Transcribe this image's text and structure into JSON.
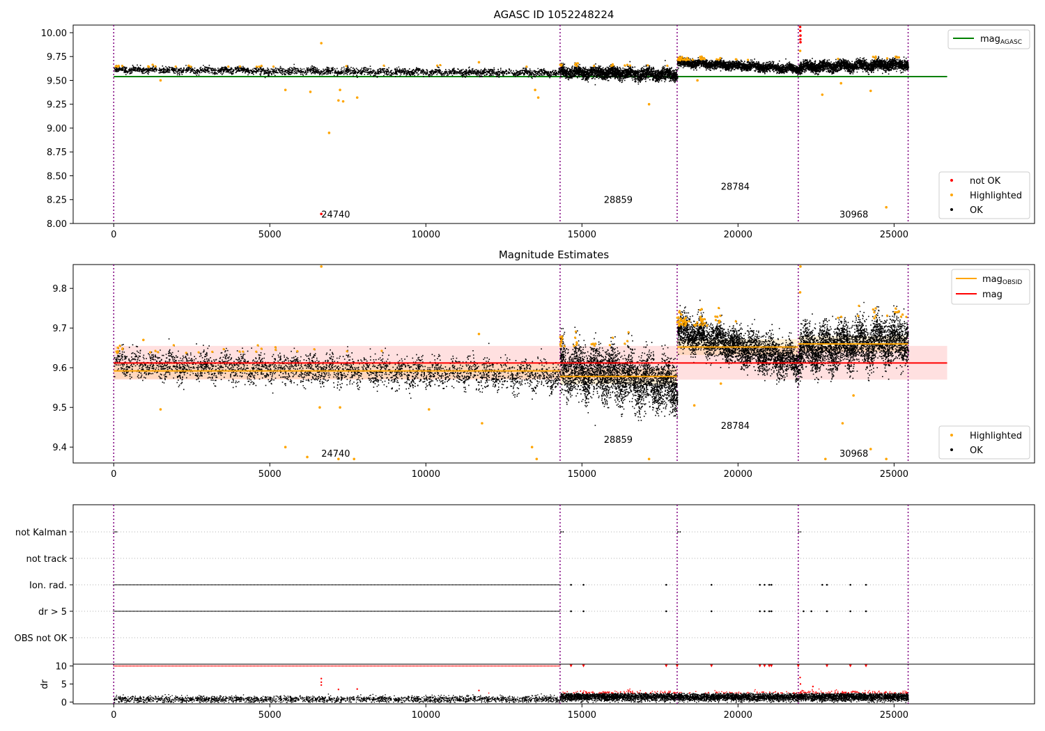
{
  "chart_data": [
    {
      "type": "scatter",
      "title": "AGASC ID 1052248224",
      "x_ticks": [
        0,
        5000,
        10000,
        15000,
        20000,
        25000
      ],
      "y_ticks": [
        "8.00",
        "8.25",
        "8.50",
        "8.75",
        "9.00",
        "9.25",
        "9.50",
        "9.75",
        "10.00"
      ],
      "xlim": [
        -1300,
        29500
      ],
      "ylim": [
        8.0,
        10.08
      ],
      "reference_line": {
        "label": "mag",
        "label_sub": "AGASC",
        "value": 9.54,
        "x_range": [
          0,
          26700
        ],
        "color": "#008000"
      },
      "obsid_boundaries": [
        0,
        14300,
        18050,
        21930,
        25450
      ],
      "segments": [
        {
          "x0": 0,
          "x1": 14300,
          "mean": 9.6,
          "slope": -0.035,
          "spread": 0.018
        },
        {
          "x0": 14300,
          "x1": 18050,
          "mean": 9.58,
          "slope": -0.03,
          "spread": 0.03
        },
        {
          "x0": 18050,
          "x1": 21930,
          "mean": 9.66,
          "slope": -0.07,
          "spread": 0.022
        },
        {
          "x0": 21930,
          "x1": 25450,
          "mean": 9.66,
          "slope": 0.03,
          "spread": 0.028
        }
      ],
      "obsid_labels": [
        {
          "text": "24740",
          "x": 6650,
          "y": 8.1
        },
        {
          "text": "28859",
          "x": 15700,
          "y": 8.25
        },
        {
          "text": "28784",
          "x": 19450,
          "y": 8.39
        },
        {
          "text": "30968",
          "x": 23250,
          "y": 8.1
        }
      ],
      "highlighted": [
        [
          6650,
          9.89
        ],
        [
          6900,
          8.95
        ],
        [
          7200,
          9.29
        ],
        [
          7350,
          9.28
        ],
        [
          7800,
          9.32
        ],
        [
          5500,
          9.4
        ],
        [
          6300,
          9.38
        ],
        [
          7250,
          9.4
        ],
        [
          1500,
          9.5
        ],
        [
          13500,
          9.4
        ],
        [
          13600,
          9.32
        ],
        [
          17150,
          9.25
        ],
        [
          22700,
          9.35
        ],
        [
          23300,
          9.47
        ],
        [
          24250,
          9.39
        ],
        [
          24750,
          8.17
        ],
        [
          11700,
          9.69
        ],
        [
          18700,
          9.5
        ],
        [
          21990,
          9.81
        ]
      ],
      "not_ok": [
        [
          6650,
          8.1
        ],
        [
          21990,
          10.06
        ],
        [
          21995,
          10.02
        ],
        [
          22000,
          9.97
        ],
        [
          21998,
          9.93
        ],
        [
          22002,
          9.9
        ]
      ],
      "legend_right": [
        {
          "label": "mag",
          "label_sub": "AGASC",
          "color": "#008000"
        }
      ],
      "legend_points": [
        {
          "label": "not OK",
          "color": "#ff0000"
        },
        {
          "label": "Highlighted",
          "color": "#ffa500"
        },
        {
          "label": "OK",
          "color": "#000000"
        }
      ]
    },
    {
      "type": "scatter",
      "title": "Magnitude Estimates",
      "x_ticks": [
        0,
        5000,
        10000,
        15000,
        20000,
        25000
      ],
      "y_ticks": [
        "9.4",
        "9.5",
        "9.6",
        "9.7",
        "9.8"
      ],
      "xlim": [
        -1300,
        29500
      ],
      "ylim": [
        9.36,
        9.86
      ],
      "mag_line": {
        "label": "mag",
        "value": 9.612,
        "band": [
          9.57,
          9.655
        ],
        "x_range": [
          0,
          26700
        ],
        "color": "#ff0000"
      },
      "obsid_mags": [
        {
          "x0": 0,
          "x1": 14300,
          "value": 9.592
        },
        {
          "x0": 14300,
          "x1": 18050,
          "value": 9.578
        },
        {
          "x0": 18050,
          "x1": 21930,
          "value": 9.652
        },
        {
          "x0": 21930,
          "x1": 25450,
          "value": 9.66
        }
      ],
      "obsid_boundaries": [
        0,
        14300,
        18050,
        21930,
        25450
      ],
      "obsid_labels": [
        {
          "text": "24740",
          "x": 6650,
          "y": 9.385
        },
        {
          "text": "28859",
          "x": 15700,
          "y": 9.42
        },
        {
          "text": "28784",
          "x": 19450,
          "y": 9.455
        },
        {
          "text": "30968",
          "x": 23250,
          "y": 9.385
        }
      ],
      "highlighted": [
        [
          6650,
          9.855
        ],
        [
          6600,
          9.5
        ],
        [
          5500,
          9.4
        ],
        [
          6200,
          9.375
        ],
        [
          7250,
          9.5
        ],
        [
          7200,
          9.37
        ],
        [
          7700,
          9.37
        ],
        [
          1500,
          9.495
        ],
        [
          10100,
          9.495
        ],
        [
          11800,
          9.46
        ],
        [
          13400,
          9.4
        ],
        [
          13550,
          9.37
        ],
        [
          17150,
          9.37
        ],
        [
          22800,
          9.37
        ],
        [
          23350,
          9.46
        ],
        [
          24250,
          9.395
        ],
        [
          24750,
          9.37
        ],
        [
          11700,
          9.685
        ],
        [
          18600,
          9.505
        ],
        [
          22000,
          9.855
        ],
        [
          21990,
          9.79
        ],
        [
          23700,
          9.53
        ],
        [
          950,
          9.67
        ],
        [
          19450,
          9.56
        ]
      ],
      "legend_right": [
        {
          "label": "mag",
          "label_sub": "OBSID",
          "color": "#ffa500"
        },
        {
          "label": "mag",
          "label_sub": "",
          "color": "#ff0000"
        }
      ],
      "legend_points": [
        {
          "label": "Highlighted",
          "color": "#ffa500"
        },
        {
          "label": "OK",
          "color": "#000000"
        }
      ]
    },
    {
      "type": "scatter",
      "title": "",
      "categories": [
        "not Kalman",
        "not track",
        "Ion. rad.",
        "dr > 5",
        "OBS not OK"
      ],
      "xlim": [
        -1300,
        29500
      ],
      "obsid_boundaries": [
        0,
        14300,
        18050,
        21930,
        25450
      ],
      "flag_segments": [
        {
          "flag": "not Kalman",
          "ranges": [
            [
              0,
              120
            ],
            [
              14300,
              14420
            ],
            [
              18050,
              18170
            ],
            [
              21930,
              22030
            ]
          ]
        },
        {
          "flag": "Ion. rad.",
          "ranges": [
            [
              0,
              14300
            ]
          ],
          "points": [
            14650,
            15050,
            17700,
            19150,
            20700,
            20850,
            21000,
            21070,
            22700,
            22850,
            23600,
            24100
          ]
        },
        {
          "flag": "dr > 5",
          "ranges": [
            [
              0,
              14300
            ]
          ],
          "points": [
            14650,
            15050,
            17700,
            19150,
            20700,
            20850,
            21000,
            21070,
            22100,
            22350,
            22850,
            23600,
            24100
          ]
        }
      ]
    },
    {
      "type": "scatter",
      "title": "",
      "ylabel": "dr",
      "x_ticks": [
        0,
        5000,
        10000,
        15000,
        20000,
        25000
      ],
      "y_ticks": [
        "0",
        "5",
        "10"
      ],
      "xlim": [
        -1300,
        29500
      ],
      "ylim": [
        -0.5,
        10.5
      ],
      "clip_value": 10,
      "obsid_boundaries": [
        0,
        14300,
        18050,
        21930,
        25450
      ]
    }
  ]
}
